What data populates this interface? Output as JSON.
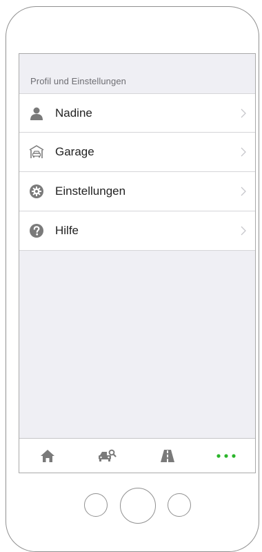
{
  "settings": {
    "section_title": "Profil und Einstellungen",
    "items": [
      {
        "label": "Nadine",
        "icon": "user-icon"
      },
      {
        "label": "Garage",
        "icon": "garage-icon"
      },
      {
        "label": "Einstellungen",
        "icon": "gear-icon"
      },
      {
        "label": "Hilfe",
        "icon": "help-icon"
      }
    ]
  },
  "tabbar": {
    "tabs": [
      {
        "icon": "home-icon",
        "active": false
      },
      {
        "icon": "car-search-icon",
        "active": false
      },
      {
        "icon": "road-icon",
        "active": false
      },
      {
        "icon": "more-dots-icon",
        "active": true
      }
    ]
  },
  "colors": {
    "accent": "#2ab52a",
    "icon": "#7a7a7a",
    "background": "#efeff4",
    "text": "#222222"
  }
}
